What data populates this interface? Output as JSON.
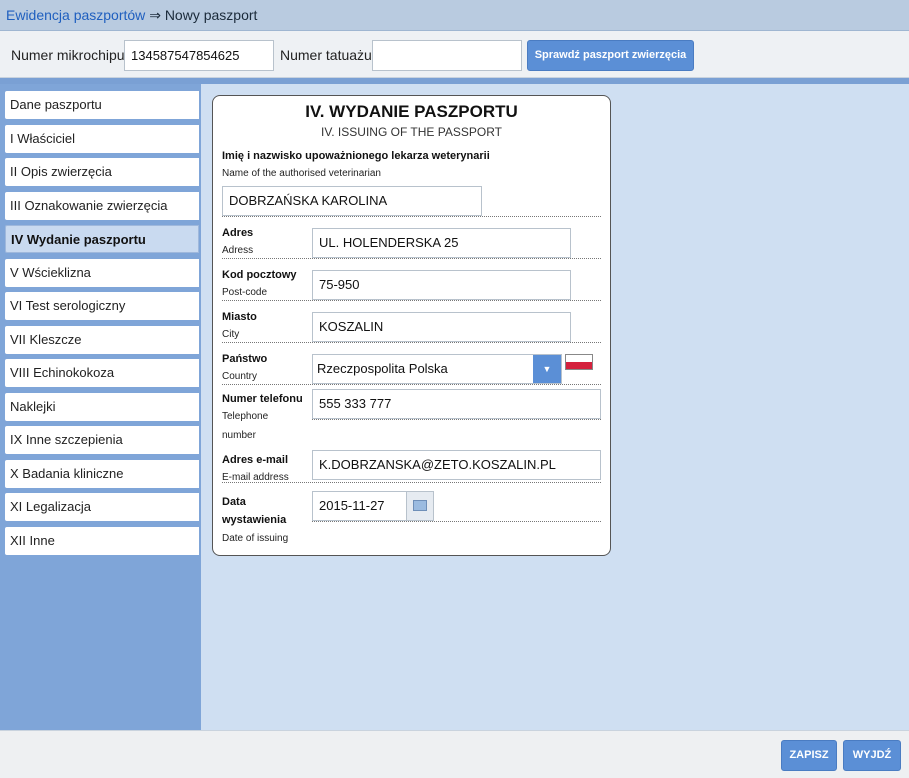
{
  "breadcrumb": {
    "link": "Ewidencja paszportów",
    "separator": "⇒",
    "current": "Nowy paszport"
  },
  "search": {
    "chip_label": "Numer mikrochipu",
    "chip_value": "134587547854625",
    "tattoo_label": "Numer tatuażu",
    "tattoo_value": "",
    "check_button": "Sprawdź paszport zwierzęcia"
  },
  "sidebar": {
    "items": [
      {
        "label": "Dane paszportu"
      },
      {
        "label": "I Właściciel"
      },
      {
        "label": "II Opis zwierzęcia"
      },
      {
        "label": "III Oznakowanie zwierzęcia"
      },
      {
        "label": "IV Wydanie paszportu"
      },
      {
        "label": "V Wścieklizna"
      },
      {
        "label": "VI Test serologiczny"
      },
      {
        "label": "VII Kleszcze"
      },
      {
        "label": "VIII Echinokokoza"
      },
      {
        "label": "Naklejki"
      },
      {
        "label": "IX Inne szczepienia"
      },
      {
        "label": "X Badania kliniczne"
      },
      {
        "label": "XI Legalizacja"
      },
      {
        "label": "XII Inne"
      }
    ],
    "active_index": 4
  },
  "form": {
    "title": "IV. WYDANIE PASZPORTU",
    "subtitle": "IV. ISSUING OF THE PASSPORT",
    "vet": {
      "label": "Imię i nazwisko upoważnionego lekarza weterynarii",
      "sublabel": "Name of the authorised veterinarian",
      "value": "DOBRZAŃSKA KAROLINA"
    },
    "address": {
      "label": "Adres",
      "sublabel": "Adress",
      "value": "UL. HOLENDERSKA 25"
    },
    "postcode": {
      "label": "Kod pocztowy",
      "sublabel": "Post-code",
      "value": "75-950"
    },
    "city": {
      "label": "Miasto",
      "sublabel": "City",
      "value": "KOSZALIN"
    },
    "country": {
      "label": "Państwo",
      "sublabel": "Country",
      "value": "Rzeczpospolita Polska"
    },
    "phone": {
      "label": "Numer telefonu",
      "sublabel_1": "Telephone",
      "sublabel_2": "number",
      "value": "555 333 777"
    },
    "email": {
      "label": "Adres e-mail",
      "sublabel": "E-mail address",
      "value": "K.DOBRZANSKA@ZETO.KOSZALIN.PL"
    },
    "date": {
      "label_1": "Data",
      "label_2": "wystawienia",
      "sublabel": "Date of issuing",
      "value": "2015-11-27"
    }
  },
  "footer": {
    "save": "ZAPISZ",
    "exit": "WYJDŹ"
  },
  "colors": {
    "accent": "#5b8fd6",
    "sidebar": "#7fa5d8",
    "content_bg": "#cfdff2"
  }
}
